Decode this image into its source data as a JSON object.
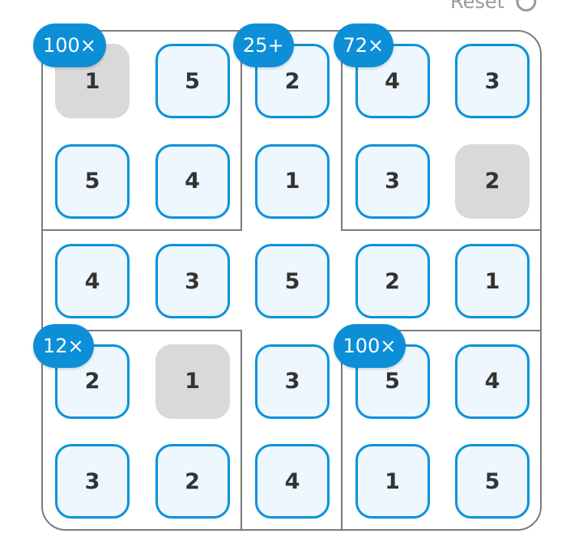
{
  "toolbar": {
    "reset_label": "Reset"
  },
  "icons": {
    "reset": "refresh-icon"
  },
  "colors": {
    "tile_border": "#0d93d9",
    "tile_fill": "#eef7fd",
    "fixed_fill": "#d9d9d9",
    "clue_badge": "#0d8fd8",
    "grid_line": "#7d7d7d"
  },
  "puzzle": {
    "size": 5,
    "grid": [
      [
        "1",
        "5",
        "2",
        "4",
        "3"
      ],
      [
        "5",
        "4",
        "1",
        "3",
        "2"
      ],
      [
        "4",
        "3",
        "5",
        "2",
        "1"
      ],
      [
        "2",
        "1",
        "3",
        "5",
        "4"
      ],
      [
        "3",
        "2",
        "4",
        "1",
        "5"
      ]
    ],
    "fixed": [
      [
        true,
        false,
        false,
        false,
        false
      ],
      [
        false,
        false,
        false,
        false,
        true
      ],
      [
        false,
        false,
        false,
        false,
        false
      ],
      [
        false,
        true,
        false,
        false,
        false
      ],
      [
        false,
        false,
        false,
        false,
        false
      ]
    ],
    "clues": [
      {
        "label": "100×",
        "row": 0,
        "col": 0
      },
      {
        "label": "25+",
        "row": 0,
        "col": 2
      },
      {
        "label": "72×",
        "row": 0,
        "col": 3
      },
      {
        "label": "12×",
        "row": 3,
        "col": 0
      },
      {
        "label": "100×",
        "row": 3,
        "col": 3
      }
    ]
  }
}
